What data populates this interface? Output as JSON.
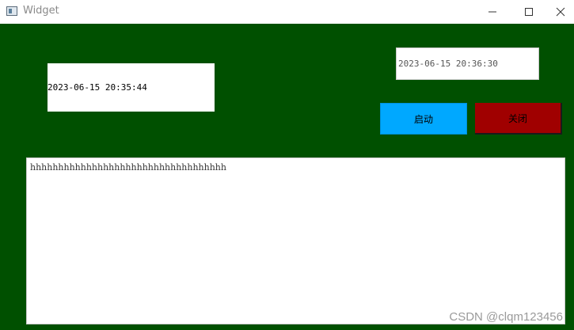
{
  "window": {
    "title": "Widget",
    "controls": [
      "minimize",
      "maximize",
      "close"
    ]
  },
  "timer": {
    "left_display": "2023-06-15 20:35:44",
    "right_display": "2023-06-15 20:36:30"
  },
  "buttons": {
    "start_label": "启动",
    "stop_label": "关闭"
  },
  "log": {
    "text": "hhhhhhhhhhhhhhhhhhhhhhhhhhhhhhhhhhh"
  },
  "watermark": "CSDN @clqm123456",
  "colors": {
    "background": "#005000",
    "start_button": "#00a8ff",
    "stop_button": "#a00000"
  }
}
